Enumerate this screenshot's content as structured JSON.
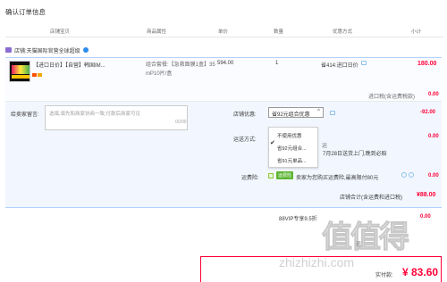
{
  "page_title": "确认订单信息",
  "columns": [
    "店铺宝贝",
    "商品属性",
    "单价",
    "数量",
    "优惠方式",
    "小计"
  ],
  "shop": {
    "label": "店铺:天猫国际官营全球超级"
  },
  "item": {
    "name": "【进口日价】【自营】韩国IM...",
    "spec_line1": "组合套餐:【急救面膜1盒】35",
    "spec_line2": "mP10片/盒",
    "price": "594.00",
    "quantity": "1",
    "promo": "省414:进口日价",
    "subtotal": "180.00"
  },
  "tax": {
    "label": "进口税(含运费税款)",
    "value": "0.00"
  },
  "message": {
    "label": "给卖家留言:",
    "placeholder": "选填,填先和商家协商一致,付款后商家可见",
    "count": "0/200"
  },
  "coupon": {
    "label": "店铺优惠:",
    "selected": "省92元组合优惠",
    "value": "-92.00",
    "options": [
      "不使用优惠",
      "省92元组合...",
      "省91元单品..."
    ]
  },
  "shipping": {
    "label": "运送方式:",
    "text1": "运",
    "text2": "7月28日送货上门,晚到必赔",
    "value": "0.00"
  },
  "insurance": {
    "label": "运费险:",
    "tag": "运费险",
    "text": "卖家为您购买运费险,最高限付80元",
    "value": "0.00"
  },
  "shop_total": {
    "label": "店铺合计(含运费和进口税)",
    "value": "¥88.00"
  },
  "vip": {
    "label": "88VIP专享9.5折",
    "value": "0.00"
  },
  "summary": {
    "pay_line": "运",
    "final_label": "实付款:",
    "final_value": "¥ 83.60"
  },
  "watermark": {
    "text": "值值得",
    "url": "zhizhizhi.com"
  },
  "colors": {
    "accent": "#ff0036",
    "link_blue": "#2d8cf0",
    "panel": "#f2f7ff"
  }
}
